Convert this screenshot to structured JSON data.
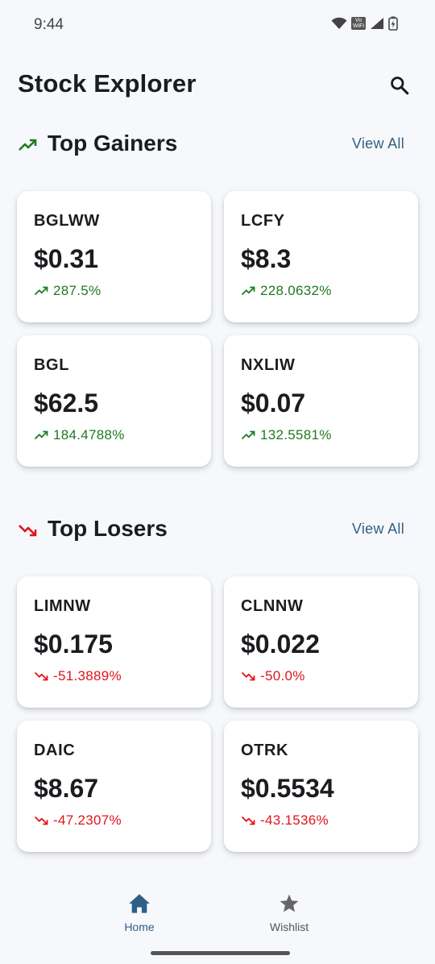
{
  "status_bar": {
    "time": "9:44",
    "vowifi_line1": "Vo",
    "vowifi_line2": "WiFi"
  },
  "header": {
    "title": "Stock Explorer"
  },
  "colors": {
    "gain": "#1f7a22",
    "loss": "#e0141b",
    "accent": "#35607f",
    "background": "#f6f8fc"
  },
  "gainers": {
    "title": "Top Gainers",
    "view_all": "View All",
    "items": [
      {
        "symbol": "BGLWW",
        "price": "$0.31",
        "change": "287.5%"
      },
      {
        "symbol": "LCFY",
        "price": "$8.3",
        "change": "228.0632%"
      },
      {
        "symbol": "BGL",
        "price": "$62.5",
        "change": "184.4788%"
      },
      {
        "symbol": "NXLIW",
        "price": "$0.07",
        "change": "132.5581%"
      }
    ]
  },
  "losers": {
    "title": "Top Losers",
    "view_all": "View All",
    "items": [
      {
        "symbol": "LIMNW",
        "price": "$0.175",
        "change": "-51.3889%"
      },
      {
        "symbol": "CLNNW",
        "price": "$0.022",
        "change": "-50.0%"
      },
      {
        "symbol": "DAIC",
        "price": "$8.67",
        "change": "-47.2307%"
      },
      {
        "symbol": "OTRK",
        "price": "$0.5534",
        "change": "-43.1536%"
      }
    ]
  },
  "nav": {
    "home_label": "Home",
    "wishlist_label": "Wishlist"
  }
}
